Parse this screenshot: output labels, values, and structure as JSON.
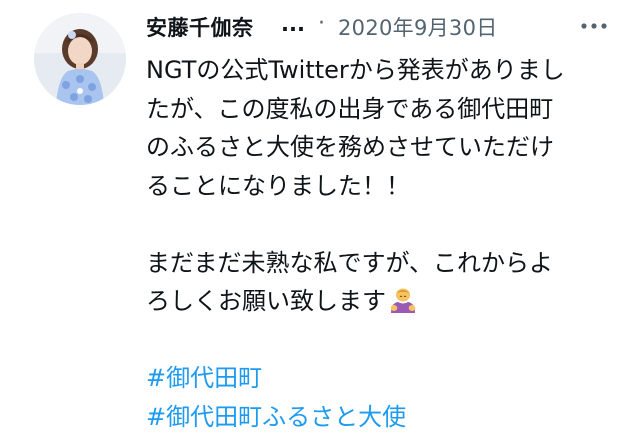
{
  "tweet": {
    "author": {
      "name": "安藤千伽奈",
      "truncation": "..."
    },
    "separator": "·",
    "date": "2020年9月30日",
    "more_icon": "more-options-icon",
    "body_lines": [
      "NGTの公式Twitterから発表がありまし",
      "たが、この度私の出身である御代田町",
      "のふるさと大使を務めさせていただけ",
      "ることになりました！！",
      "",
      "まだまだ未熟な私ですが、これからよ",
      "ろしくお願い致します"
    ],
    "body_emoji": "person-bowing-emoji",
    "hashtags": [
      "#御代田町",
      "#御代田町ふるさと大使"
    ],
    "colors": {
      "hashtag": "#1d9bf0",
      "secondary_text": "#536471",
      "primary_text": "#0f1419"
    }
  }
}
